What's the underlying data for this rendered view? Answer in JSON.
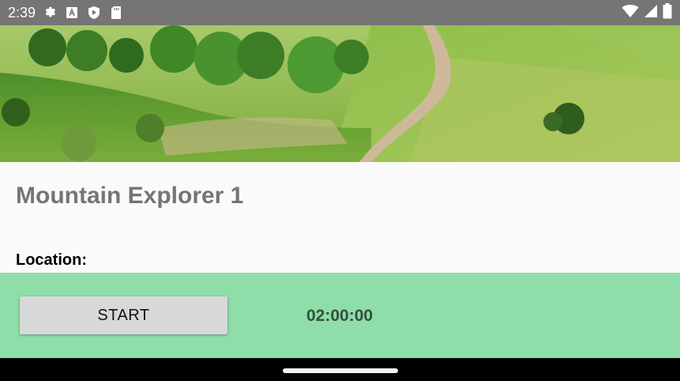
{
  "status_bar": {
    "time": "2:39",
    "left_icons": [
      "gear-icon",
      "a-box-icon",
      "shield-play-icon",
      "sd-card-icon"
    ],
    "right_icons": [
      "wifi-icon",
      "cell-signal-icon",
      "battery-icon"
    ]
  },
  "hero": {
    "image": "green hillside with dirt trail"
  },
  "main": {
    "title": "Mountain Explorer 1",
    "location_label": "Location:"
  },
  "panel": {
    "start_label": "START",
    "timer": "02:00:00",
    "color": "#8fdda9"
  },
  "colors": {
    "status_bar": "#757575",
    "title": "#757575",
    "button": "#d7d9d8"
  }
}
